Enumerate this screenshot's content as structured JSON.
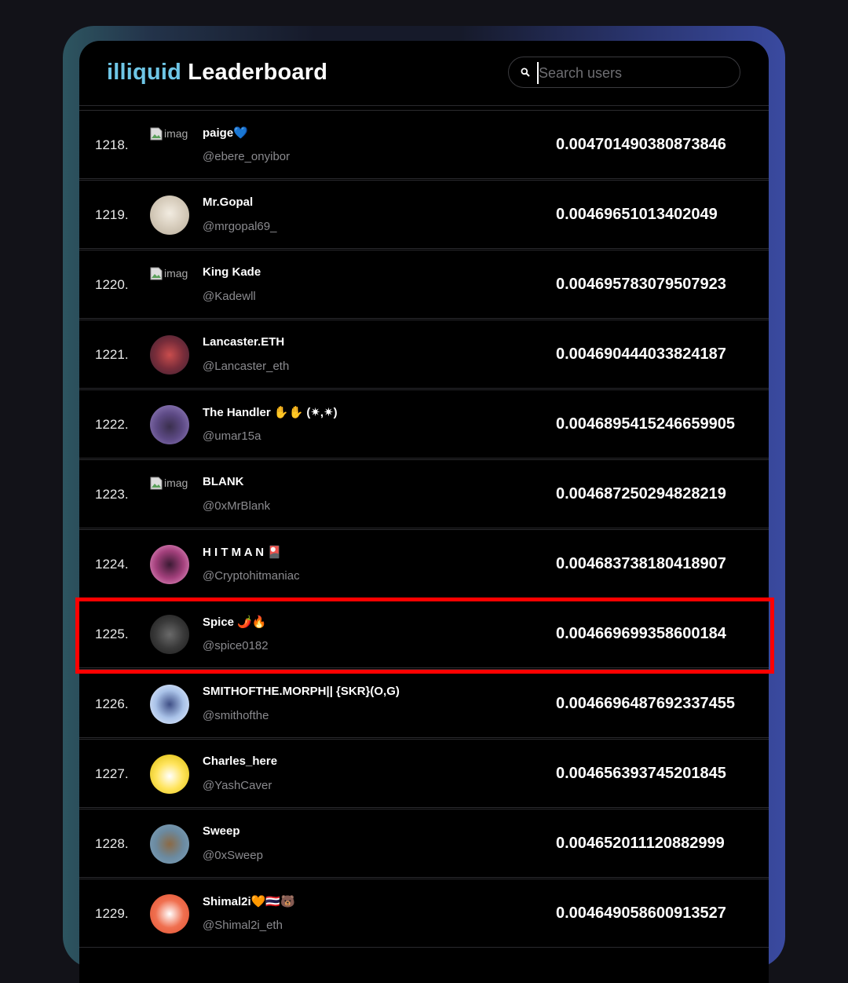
{
  "header": {
    "brand": "illiquid",
    "title": "Leaderboard",
    "search_placeholder": "Search users"
  },
  "colors": {
    "brand": "#6ec6e6",
    "highlight": "#ff0000"
  },
  "rows": [
    {
      "rank": "1218.",
      "name": "paige💙",
      "handle": "@ebere_onyibor",
      "score": "0.004701490380873846",
      "avatar": "broken-image",
      "avatar_alt": "image"
    },
    {
      "rank": "1219.",
      "name": "Mr.Gopal",
      "handle": "@mrgopal69_",
      "score": "0.00469651013402049",
      "avatar": "avatar-1219"
    },
    {
      "rank": "1220.",
      "name": "King Kade",
      "handle": "@Kadewll",
      "score": "0.004695783079507923",
      "avatar": "broken-image",
      "avatar_alt": "image"
    },
    {
      "rank": "1221.",
      "name": "Lancaster.ETH",
      "handle": "@Lancaster_eth",
      "score": "0.004690444033824187",
      "avatar": "avatar-1221"
    },
    {
      "rank": "1222.",
      "name": "The Handler ✋✋ (✷,✷)",
      "handle": "@umar15a",
      "score": "0.004689541524665990 5",
      "avatar": "avatar-1222"
    },
    {
      "rank": "1223.",
      "name": "BLANK",
      "handle": "@0xMrBlank",
      "score": "0.004687250294828219",
      "avatar": "broken-image",
      "avatar_alt": "image"
    },
    {
      "rank": "1224.",
      "name": "H I T M A N 🎴",
      "handle": "@Cryptohitmaniac",
      "score": "0.004683738180418907",
      "avatar": "avatar-1224"
    },
    {
      "rank": "1225.",
      "name": "Spice 🌶️🔥",
      "handle": "@spice0182",
      "score": "0.004669699358600184",
      "avatar": "avatar-1225",
      "highlighted": true
    },
    {
      "rank": "1226.",
      "name": "SMITHOFTHE.MORPH|| {SKR}(O,G)",
      "handle": "@smithofthe",
      "score": "0.004669648769233745 5",
      "avatar": "avatar-1226"
    },
    {
      "rank": "1227.",
      "name": "Charles_here",
      "handle": "@YashCaver",
      "score": "0.004656393745201845",
      "avatar": "avatar-1227"
    },
    {
      "rank": "1228.",
      "name": "Sweep",
      "handle": "@0xSweep",
      "score": "0.004652011120882999",
      "avatar": "avatar-1228"
    },
    {
      "rank": "1229.",
      "name": "Shimal2i🧡🇹🇭🐻",
      "handle": "@Shimal2i_eth",
      "score": "0.004649058600913527",
      "avatar": "avatar-1229"
    }
  ]
}
